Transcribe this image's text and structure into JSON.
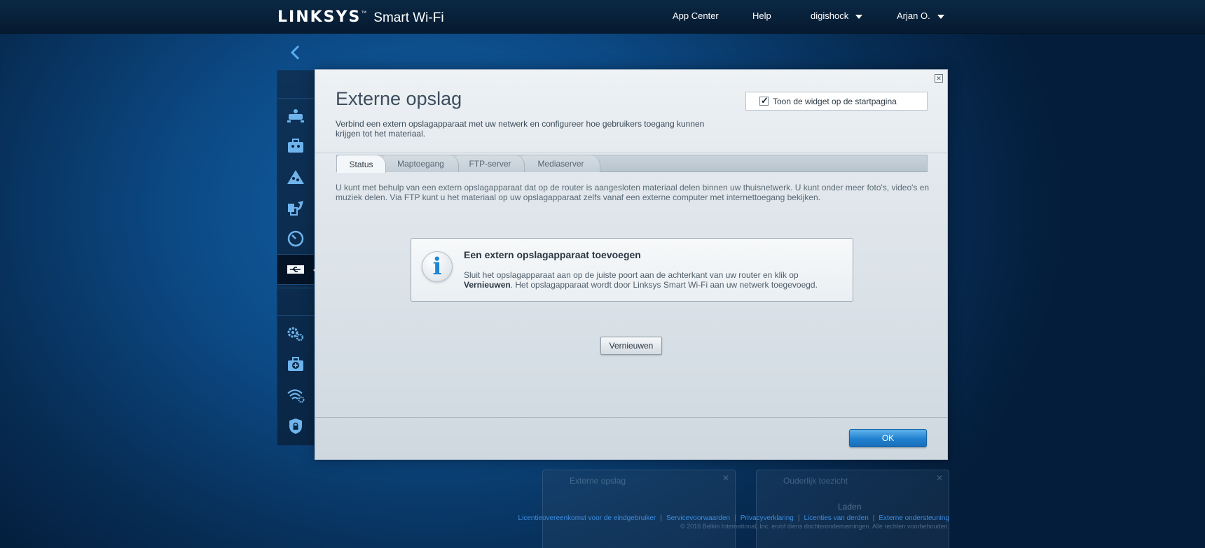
{
  "header": {
    "brand": "LINKSYS",
    "trademark": "™",
    "product": "Smart Wi-Fi",
    "nav": {
      "app_center": "App Center",
      "help": "Help",
      "router_name": "digishock",
      "user_name": "Arjan O."
    }
  },
  "sidebar": {
    "icons": [
      "network-map-icon",
      "guest-access-icon",
      "parental-controls-icon",
      "media-prioritization-icon",
      "speed-test-icon",
      "usb-storage-icon",
      "settings-gears-icon",
      "troubleshooting-icon",
      "wireless-icon",
      "security-icon"
    ],
    "active": "usb-storage-icon"
  },
  "modal": {
    "title": "Externe opslag",
    "description": "Verbind een extern opslagapparaat met uw netwerk en configureer hoe gebruikers toegang kunnen krijgen tot het materiaal.",
    "show_widget_label": "Toon de widget op de startpagina",
    "show_widget_checked": true,
    "tabs": [
      {
        "label": "Status",
        "active": true
      },
      {
        "label": "Maptoegang",
        "active": false
      },
      {
        "label": "FTP-server",
        "active": false
      },
      {
        "label": "Mediaserver",
        "active": false
      }
    ],
    "intro": "U kunt met behulp van een extern opslagapparaat dat op de router is aangesloten materiaal delen binnen uw thuisnetwerk. U kunt onder meer foto's, video's en muziek delen. Via FTP kunt u het materiaal op uw opslagapparaat zelfs vanaf een externe computer met internettoegang bekijken.",
    "info": {
      "title": "Een extern opslagapparaat toevoegen",
      "text_before": "Sluit het opslagapparaat aan op de juiste poort aan de achterkant van uw router en klik op ",
      "text_bold": "Vernieuwen",
      "text_after": ". Het opslagapparaat wordt door Linksys Smart Wi-Fi aan uw netwerk toegevoegd."
    },
    "refresh_label": "Vernieuwen",
    "ok_label": "OK"
  },
  "background": {
    "widget_left_title": "Externe opslag",
    "widget_right_title": "Ouderlijk toezicht",
    "loading": "Laden"
  },
  "footer": {
    "links": [
      "Licentieovereenkomst voor de eindgebruiker",
      "Servicevoorwaarden",
      "Privacyverklaring",
      "Licenties van derden",
      "Externe ondersteuning"
    ],
    "copyright": "© 2016 Belkin International, Inc. en/of diens dochterondernemingen. Alle rechten voorbehouden."
  },
  "colors": {
    "accent_blue": "#2180cf",
    "header_bg": "#0b2845",
    "link_blue": "#3c8de0"
  }
}
